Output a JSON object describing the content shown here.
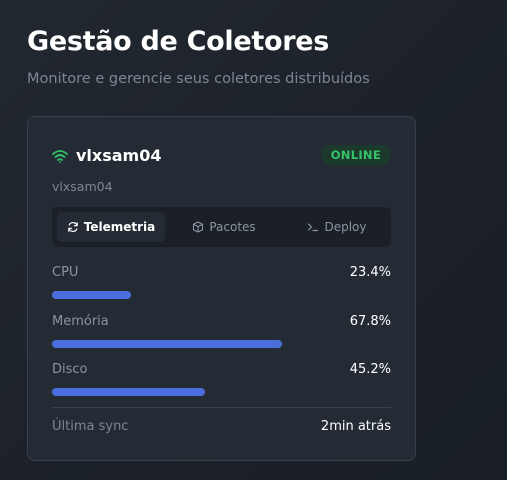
{
  "header": {
    "title": "Gestão de Coletores",
    "subtitle": "Monitore e gerencie seus coletores distribuídos"
  },
  "collector": {
    "name": "vlxsam04",
    "host": "vlxsam04",
    "status": "ONLINE",
    "status_color": "#34c46a",
    "icon": "wifi-icon"
  },
  "tabs": [
    {
      "label": "Telemetria",
      "icon": "refresh-icon",
      "active": true
    },
    {
      "label": "Pacotes",
      "icon": "package-icon",
      "active": false
    },
    {
      "label": "Deploy",
      "icon": "terminal-icon",
      "active": false
    }
  ],
  "metrics": [
    {
      "label": "CPU",
      "value": "23.4%",
      "fraction": 0.234
    },
    {
      "label": "Memória",
      "value": "67.8%",
      "fraction": 0.678
    },
    {
      "label": "Disco",
      "value": "45.2%",
      "fraction": 0.452
    }
  ],
  "sync": {
    "label": "Última sync",
    "value": "2min atrás"
  },
  "colors": {
    "accent": "#4a6fdc",
    "online": "#34c46a"
  }
}
